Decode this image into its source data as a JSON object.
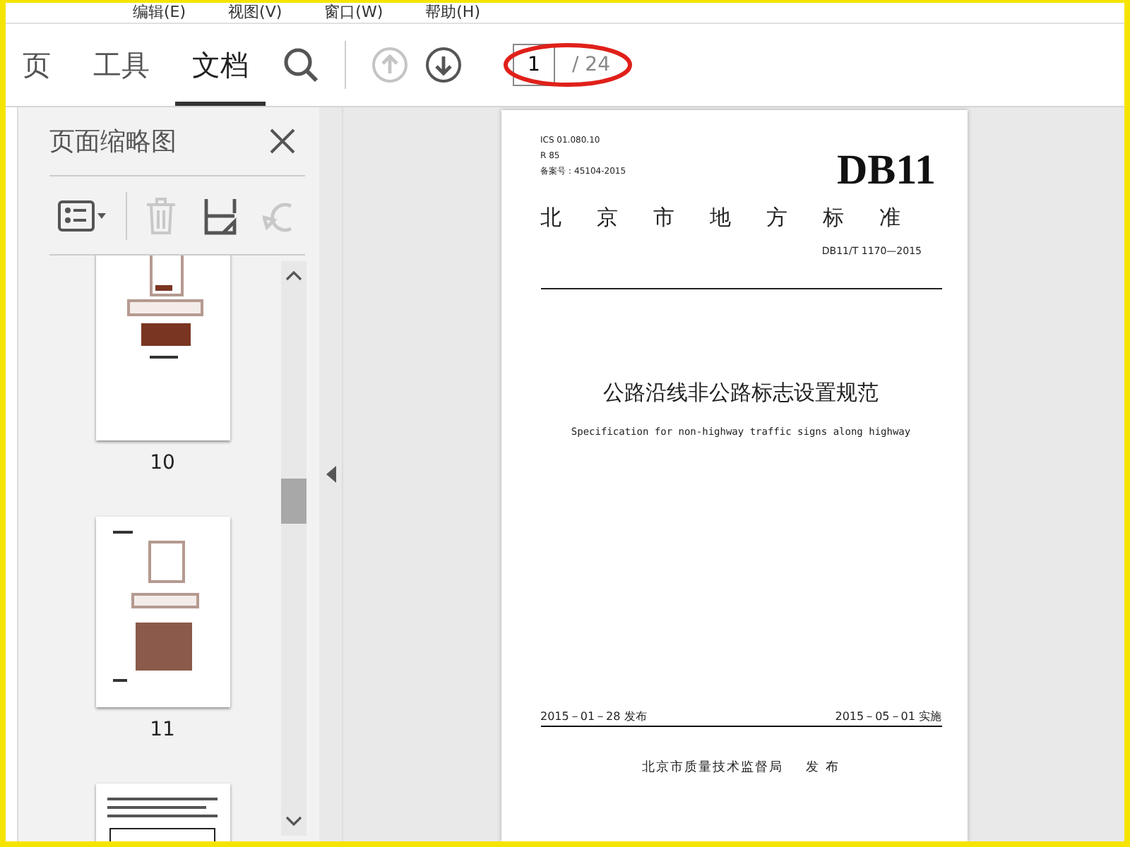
{
  "menu": [
    "编辑(E)",
    "视图(V)",
    "窗口(W)",
    "帮助(H)"
  ],
  "tabs": [
    {
      "label": "页",
      "selected": false
    },
    {
      "label": "工具",
      "selected": false
    },
    {
      "label": "文档",
      "selected": true
    }
  ],
  "page_nav": {
    "current": "1",
    "total": "/ 24",
    "prev_disabled": true
  },
  "thumbnails_panel": {
    "title": "页面缩略图",
    "pages": [
      {
        "label": "10"
      },
      {
        "label": "11"
      }
    ]
  },
  "document": {
    "header_lines": [
      "ICS 01.080.10",
      "R 85",
      "备案号：45104-2015"
    ],
    "code": "DB11",
    "category": "北京市地方标准",
    "number": "DB11/T 1170—2015",
    "title_cn": "公路沿线非公路标志设置规范",
    "title_en": "Specification for non-highway traffic signs along highway",
    "issued": "2015－01－28 发布",
    "effective": "2015－05－01 实施",
    "publisher": "北京市质量技术监督局",
    "publisher_action": "发 布"
  }
}
